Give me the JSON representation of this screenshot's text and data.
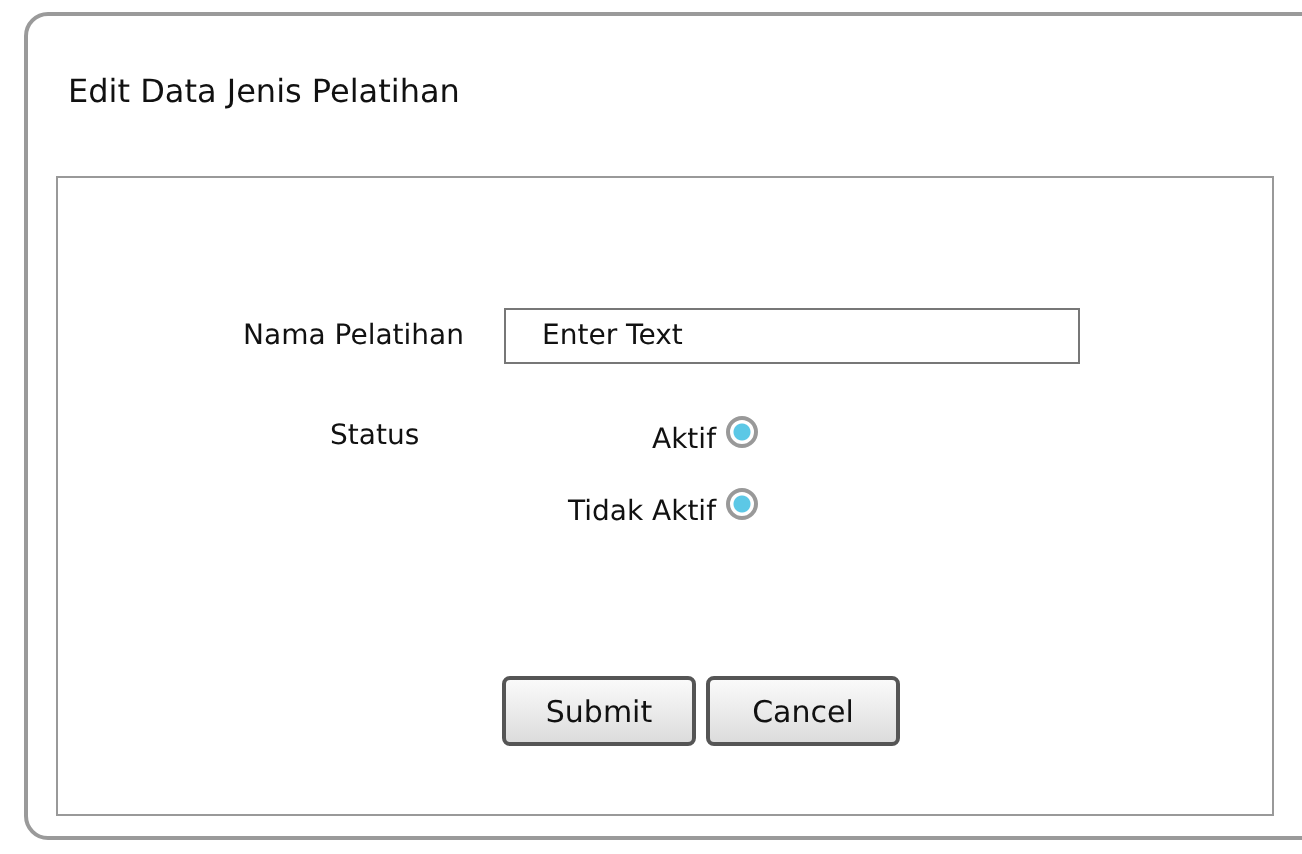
{
  "window": {
    "title": "Edit Data Jenis Pelatihan"
  },
  "form": {
    "name_label": "Nama Pelatihan",
    "name_field": {
      "value": "Enter Text"
    },
    "status_label": "Status",
    "status_options": [
      {
        "label": "Aktif",
        "selected": true
      },
      {
        "label": "Tidak Aktif",
        "selected": true
      }
    ]
  },
  "buttons": [
    "Submit",
    "Cancel"
  ]
}
